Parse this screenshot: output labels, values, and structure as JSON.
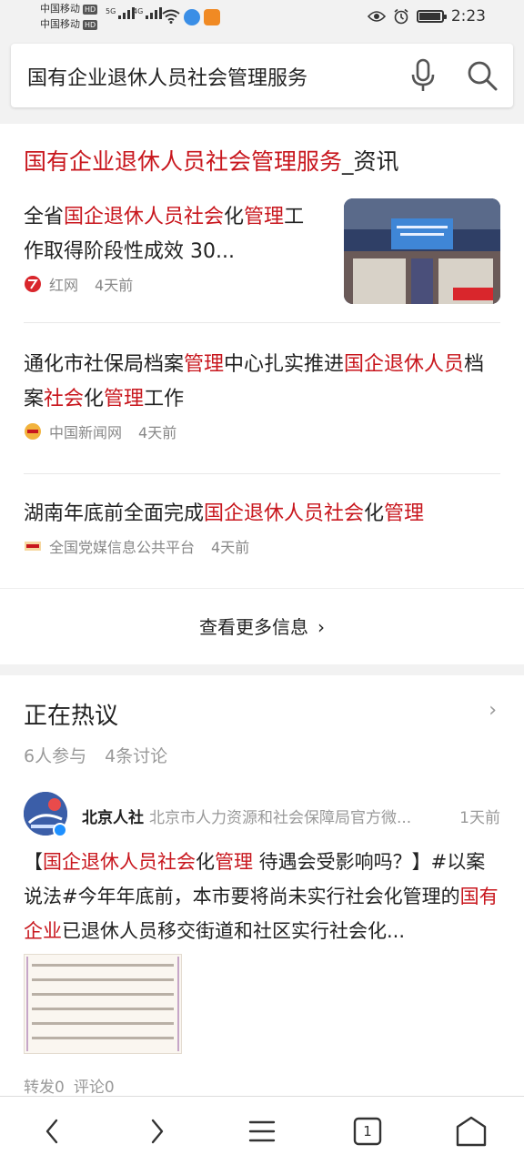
{
  "status": {
    "carrier1": "中国移动",
    "carrier2": "中国移动",
    "hd": "HD",
    "net1": "5G",
    "net2": "4G",
    "time": "2:23",
    "battery_level": 0.95,
    "icons": [
      "signal-icon",
      "wifi-icon",
      "eye-icon",
      "alarm-icon",
      "battery-icon"
    ]
  },
  "search": {
    "query": "国有企业退休人员社会管理服务"
  },
  "section": {
    "title_highlight": "国有企业退休人员社会管理服务",
    "title_suffix": "_资讯"
  },
  "news": [
    {
      "title_parts": [
        [
          "全省",
          false
        ],
        [
          "国企退休人员社会",
          true
        ],
        [
          "化",
          false
        ],
        [
          "管理",
          true
        ],
        [
          "工作取得阶段性成效 30...",
          false
        ]
      ],
      "source": "红网",
      "time": "4天前"
    },
    {
      "title_parts": [
        [
          "通化市社保局档案",
          false
        ],
        [
          "管理",
          true
        ],
        [
          "中心扎实推进",
          false
        ],
        [
          "国企退休人员",
          true
        ],
        [
          "档案",
          false
        ],
        [
          "社会",
          true
        ],
        [
          "化",
          false
        ],
        [
          "管理",
          true
        ],
        [
          "工作",
          false
        ]
      ],
      "source": "中国新闻网",
      "time": "4天前"
    },
    {
      "title_parts": [
        [
          "湖南年底前全面完成",
          false
        ],
        [
          "国企退休人员社会",
          true
        ],
        [
          "化",
          false
        ],
        [
          "管理",
          true
        ]
      ],
      "source": "全国党媒信息公共平台",
      "time": "4天前"
    }
  ],
  "more_label": "查看更多信息",
  "hot": {
    "title": "正在热议",
    "participants": "6人参与",
    "discussions": "4条讨论",
    "post": {
      "author": "北京人社",
      "author_desc": "北京市人力资源和社会保障局官方微...",
      "time": "1天前",
      "text_parts": [
        [
          "【",
          false
        ],
        [
          "国企退休人员社会",
          true
        ],
        [
          "化",
          false
        ],
        [
          "管理",
          true
        ],
        [
          " 待遇会受影响吗？】#以案说法#今年年底前，本市要将尚未实行社会化管理的",
          false
        ],
        [
          "国有企业",
          true
        ],
        [
          "已退休人员移交街道和社区实行社会化...",
          false
        ]
      ],
      "reposts": "转发0",
      "comments": "评论0"
    }
  },
  "nav": {
    "tab_count": "1",
    "icons": [
      "back-icon",
      "forward-icon",
      "menu-icon",
      "tabs-icon",
      "home-icon"
    ]
  },
  "colors": {
    "highlight": "#c8161d",
    "background": "#f2f2f2"
  }
}
